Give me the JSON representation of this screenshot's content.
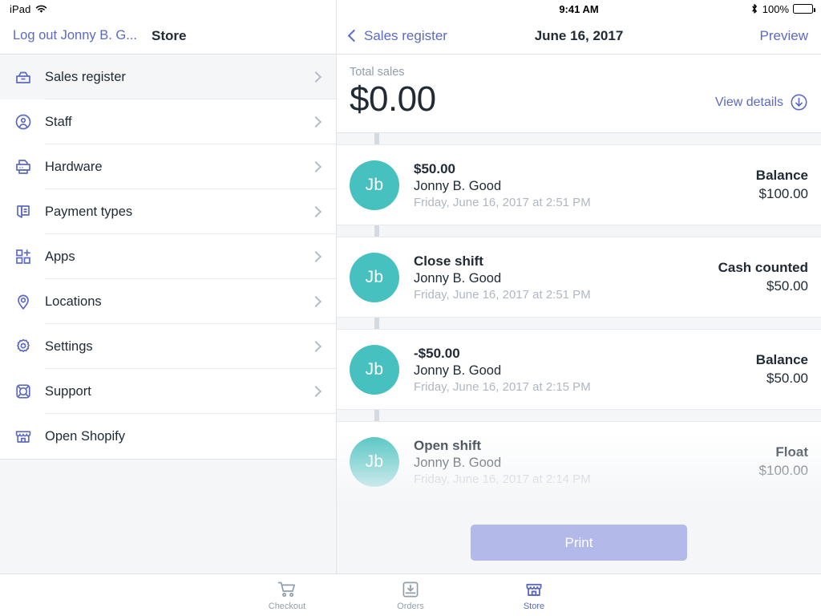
{
  "colors": {
    "accent": "#5c6ac4",
    "avatar_teal": "#47c1bf",
    "text": "#212b36",
    "muted": "#919eab",
    "surface": "#f4f6f8",
    "print_button": "#b3b9e8"
  },
  "left_pane": {
    "status": {
      "device": "iPad",
      "wifi_icon": "wifi-icon"
    },
    "header": {
      "logout_label": "Log out Jonny B. G...",
      "title": "Store"
    },
    "menu": [
      {
        "label": "Sales register",
        "icon": "cash-drawer-icon",
        "selected": true,
        "chevron": true
      },
      {
        "label": "Staff",
        "icon": "person-circle-icon",
        "selected": false,
        "chevron": true
      },
      {
        "label": "Hardware",
        "icon": "printer-icon",
        "selected": false,
        "chevron": true
      },
      {
        "label": "Payment types",
        "icon": "payment-card-stack-icon",
        "selected": false,
        "chevron": true
      },
      {
        "label": "Apps",
        "icon": "apps-grid-plus-icon",
        "selected": false,
        "chevron": true
      },
      {
        "label": "Locations",
        "icon": "map-pin-icon",
        "selected": false,
        "chevron": true
      },
      {
        "label": "Settings",
        "icon": "gear-icon",
        "selected": false,
        "chevron": true
      },
      {
        "label": "Support",
        "icon": "life-buoy-icon",
        "selected": false,
        "chevron": true
      },
      {
        "label": "Open Shopify",
        "icon": "storefront-icon",
        "selected": false,
        "chevron": false
      }
    ]
  },
  "right_pane": {
    "status": {
      "time": "9:41 AM",
      "bluetooth_icon": "bluetooth-icon",
      "battery_percent": "100%",
      "battery_icon": "battery-full-icon"
    },
    "nav": {
      "back_label": "Sales register",
      "back_icon": "chevron-left-icon",
      "title": "June 16, 2017",
      "action_label": "Preview"
    },
    "totals": {
      "label": "Total sales",
      "value": "$0.00",
      "view_details_label": "View details",
      "view_details_icon": "circle-arrow-down-icon"
    },
    "timeline": [
      {
        "avatar_initials": "Jb",
        "title": "$50.00",
        "person": "Jonny B. Good",
        "date": "Friday, June 16, 2017 at 2:51 PM",
        "right_label": "Balance",
        "right_value": "$100.00",
        "faded": false
      },
      {
        "avatar_initials": "Jb",
        "title": "Close shift",
        "person": "Jonny B. Good",
        "date": "Friday, June 16, 2017 at 2:51 PM",
        "right_label": "Cash counted",
        "right_value": "$50.00",
        "faded": false
      },
      {
        "avatar_initials": "Jb",
        "title": "-$50.00",
        "person": "Jonny B. Good",
        "date": "Friday, June 16, 2017 at 2:15 PM",
        "right_label": "Balance",
        "right_value": "$50.00",
        "faded": false
      },
      {
        "avatar_initials": "Jb",
        "title": "Open shift",
        "person": "Jonny B. Good",
        "date": "Friday, June 16, 2017 at 2:14 PM",
        "right_label": "Float",
        "right_value": "$100.00",
        "faded": true
      }
    ],
    "print_button_label": "Print"
  },
  "tabbar": [
    {
      "label": "Checkout",
      "icon": "shopping-cart-icon",
      "active": false
    },
    {
      "label": "Orders",
      "icon": "inbox-download-icon",
      "active": false
    },
    {
      "label": "Store",
      "icon": "storefront-icon",
      "active": true
    }
  ]
}
